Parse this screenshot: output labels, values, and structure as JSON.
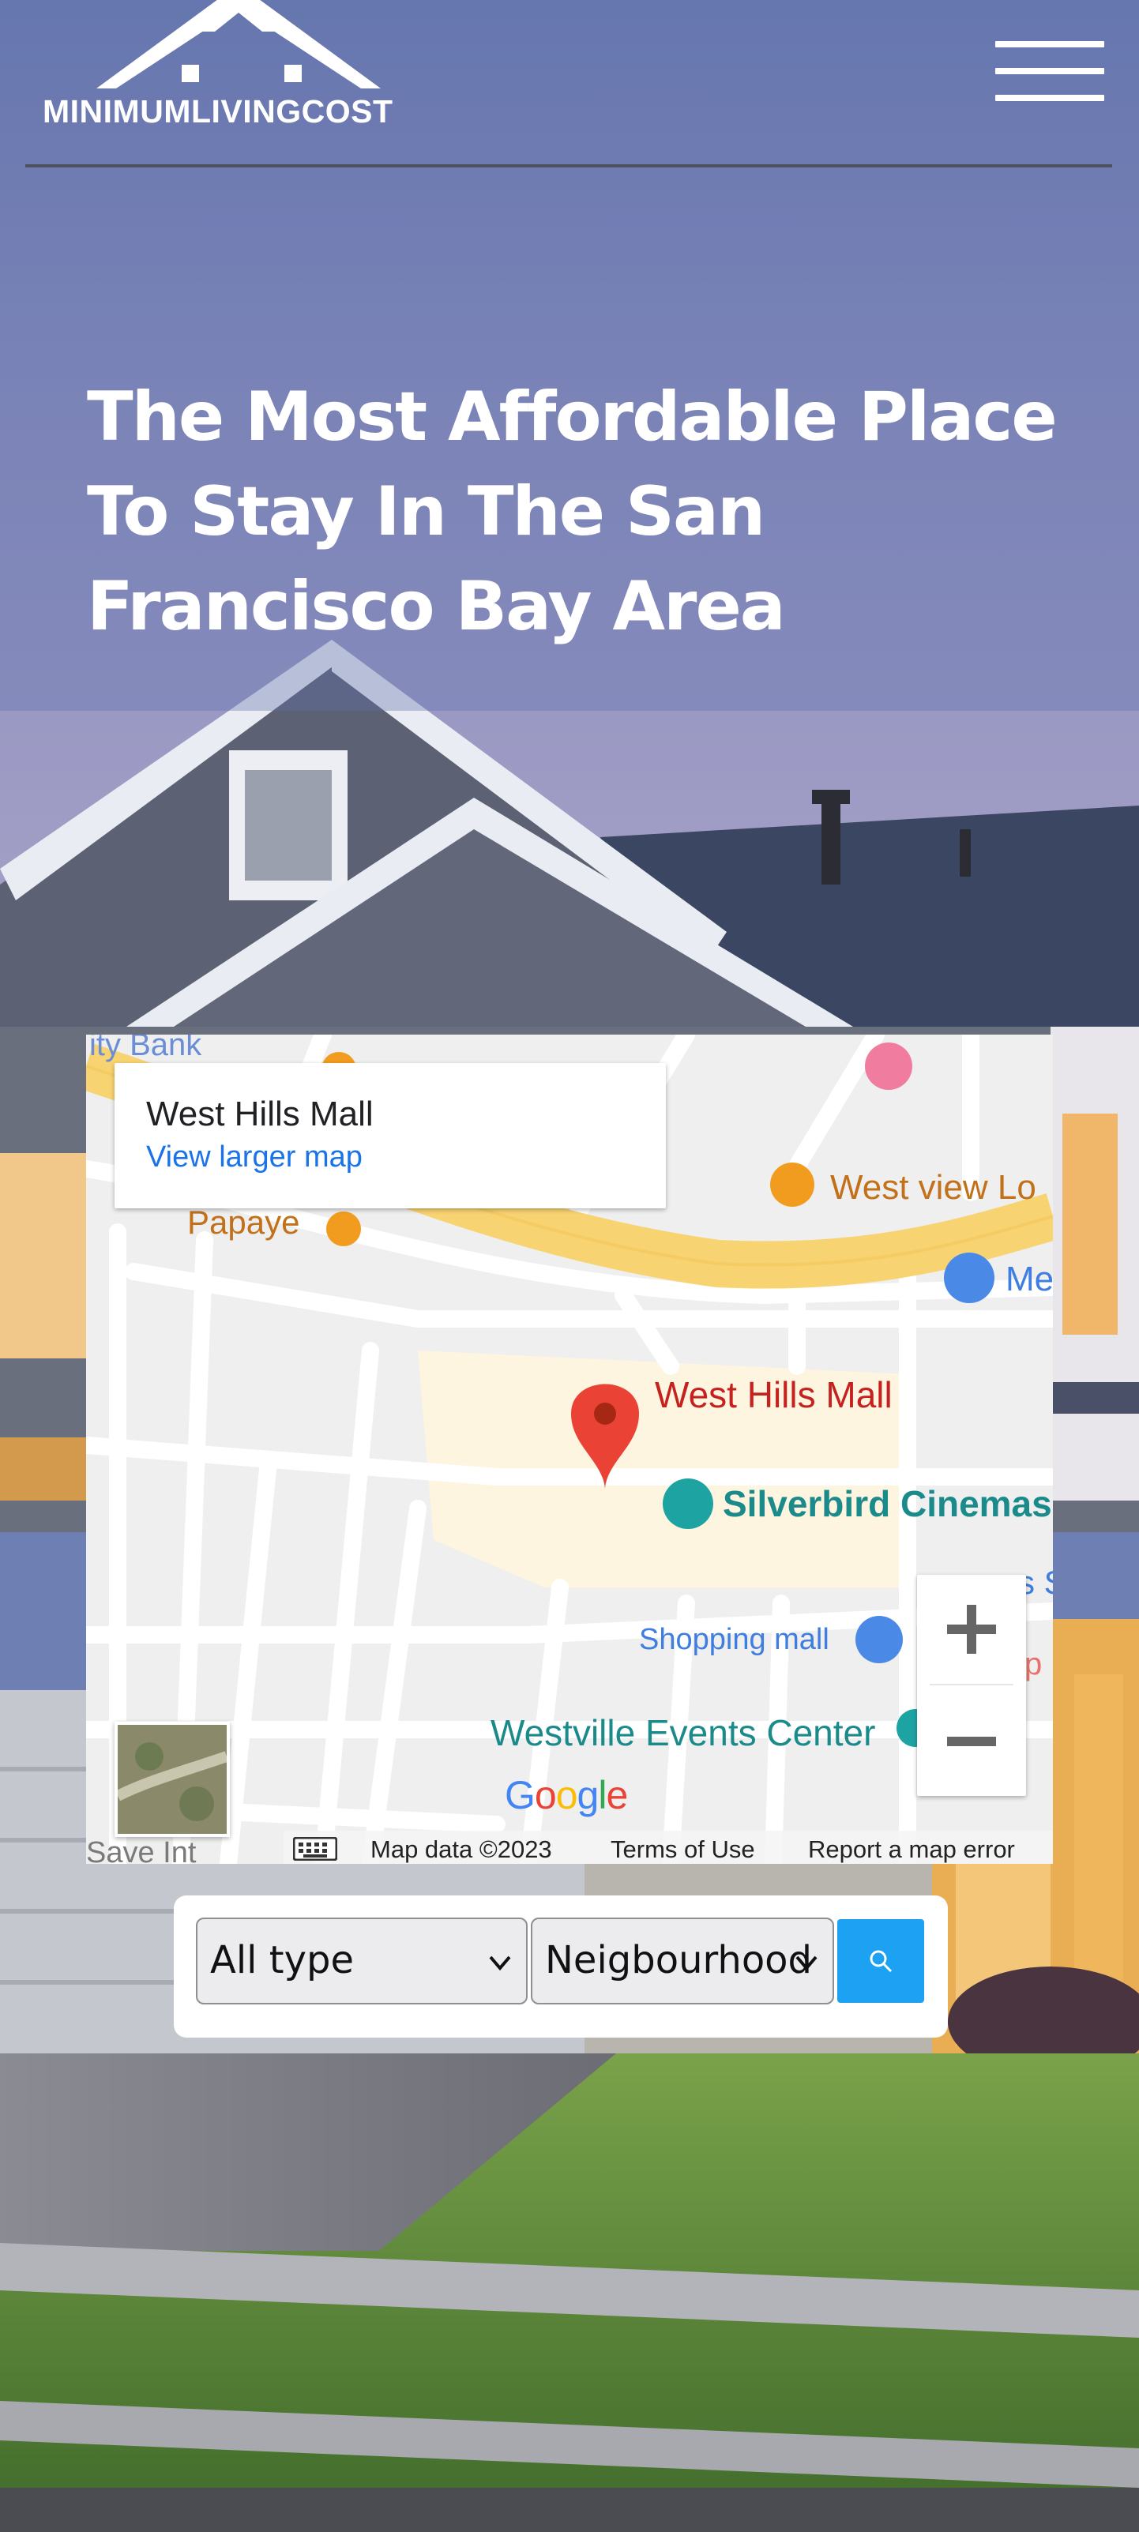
{
  "brand": {
    "logo_text": "MINIMUMLIVINGCOST"
  },
  "header": {
    "menu_icon": "hamburger-menu-icon"
  },
  "hero": {
    "headline": "The Most Affordable Place To Stay In The San Francisco Bay Area"
  },
  "map": {
    "place_name": "West Hills Mall",
    "view_larger_map": "View larger map",
    "labels": {
      "bank": "ity Bank",
      "papaye": "Papaye",
      "west_view": "West view Lo",
      "me": "Me",
      "mall": "West Hills Mall",
      "cinemas": "Silverbird Cinemas",
      "shopping_mall": "Shopping mall",
      "events_center": "Westville Events Center",
      "save": "Save Int",
      "cut_p": "p",
      "cut_s": "s S"
    },
    "logo": {
      "g1": "G",
      "o1": "o",
      "o2": "o",
      "g2": "g",
      "l": "l",
      "e": "e"
    },
    "attribution": {
      "map_data": "Map data ©2023",
      "terms": "Terms of Use",
      "report": "Report a map error"
    },
    "colors": {
      "road_major": "#f8d372",
      "road_minor": "#ffffff",
      "land": "#eeefee",
      "mall_area": "#fdf5e0",
      "pin_red": "#ea4335",
      "poi_teal": "#1ea3a3",
      "poi_blue": "#4b89e6",
      "poi_orange": "#f29c1f"
    }
  },
  "search": {
    "type_select": "All type",
    "neighbourhood_select": "Neigbourhood",
    "button_icon": "search-icon"
  },
  "colors": {
    "search_button": "#1da1f2",
    "link": "#1a73e8"
  }
}
